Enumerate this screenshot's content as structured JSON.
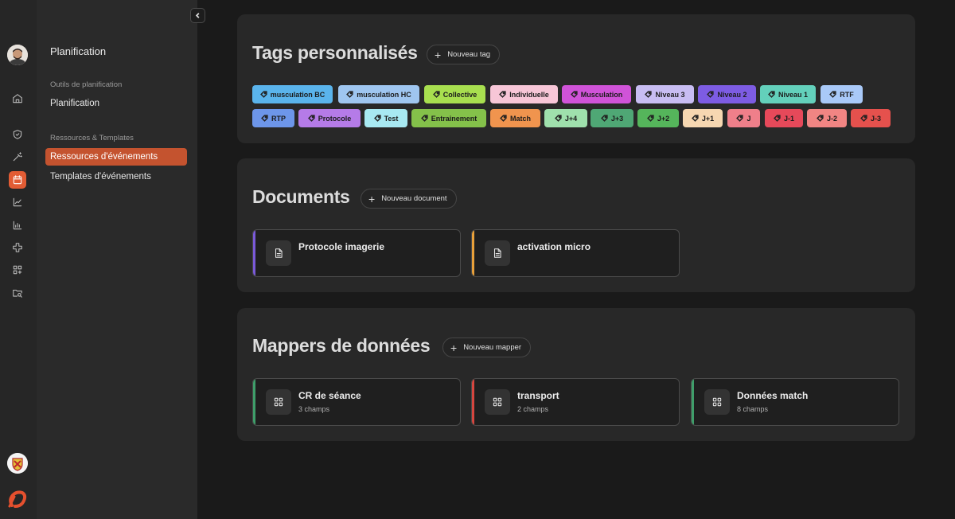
{
  "rail": {
    "icons": [
      "home-icon",
      "shield-icon",
      "magic-wand-icon",
      "calendar-icon",
      "line-chart-icon",
      "bar-chart-icon",
      "medical-cross-icon",
      "grid-plus-icon",
      "folder-search-icon"
    ],
    "accent": "#e25c34"
  },
  "sidebar": {
    "title": "Planification",
    "sections": [
      {
        "label": "Outils de planification",
        "items": [
          {
            "label": "Planification"
          }
        ]
      },
      {
        "label": "Ressources & Templates",
        "items": [
          {
            "label": "Ressources d'événements",
            "active": true
          },
          {
            "label": "Templates d'événements"
          }
        ]
      }
    ]
  },
  "tags_section": {
    "title": "Tags personnalisés",
    "new_button": "Nouveau tag",
    "tags": [
      {
        "label": "musculation BC",
        "color": "#5ab4ec"
      },
      {
        "label": "musculation HC",
        "color": "#9fc6f0"
      },
      {
        "label": "Collective",
        "color": "#a8df4f"
      },
      {
        "label": "Individuelle",
        "color": "#f7c6d7"
      },
      {
        "label": "Musculation",
        "color": "#d053d8"
      },
      {
        "label": "Niveau 3",
        "color": "#c8bdf2"
      },
      {
        "label": "Niveau 2",
        "color": "#7d5ce3"
      },
      {
        "label": "Niveau 1",
        "color": "#63d0bb"
      },
      {
        "label": "RTF",
        "color": "#a9c9f8"
      },
      {
        "label": "RTP",
        "color": "#6d96ea"
      },
      {
        "label": "Protocole",
        "color": "#b57be8"
      },
      {
        "label": "Test",
        "color": "#a8e9f2"
      },
      {
        "label": "Entrainement",
        "color": "#84c14a"
      },
      {
        "label": "Match",
        "color": "#f0944e"
      },
      {
        "label": "J+4",
        "color": "#9fe0ac"
      },
      {
        "label": "J+3",
        "color": "#4fa775"
      },
      {
        "label": "J+2",
        "color": "#55b55b"
      },
      {
        "label": "J+1",
        "color": "#f6d7b1"
      },
      {
        "label": "J",
        "color": "#ef7f8a"
      },
      {
        "label": "J-1",
        "color": "#e6495a"
      },
      {
        "label": "J-2",
        "color": "#f18583"
      },
      {
        "label": "J-3",
        "color": "#e5514d"
      }
    ]
  },
  "documents_section": {
    "title": "Documents",
    "new_button": "Nouveau document",
    "items": [
      {
        "title": "Protocole imagerie",
        "accent": "#7a5ad8",
        "icon": "document-icon"
      },
      {
        "title": "activation micro",
        "accent": "#e8a03a",
        "icon": "document-icon"
      }
    ]
  },
  "mappers_section": {
    "title": "Mappers de données",
    "new_button": "Nouveau mapper",
    "items": [
      {
        "title": "CR de séance",
        "subtitle": "3 champs",
        "accent": "#3f9e6a",
        "icon": "grid-icon"
      },
      {
        "title": "transport",
        "subtitle": "2 champs",
        "accent": "#d6463f",
        "icon": "grid-icon"
      },
      {
        "title": "Données match",
        "subtitle": "8 champs",
        "accent": "#3f9e6a",
        "icon": "grid-icon"
      }
    ]
  }
}
